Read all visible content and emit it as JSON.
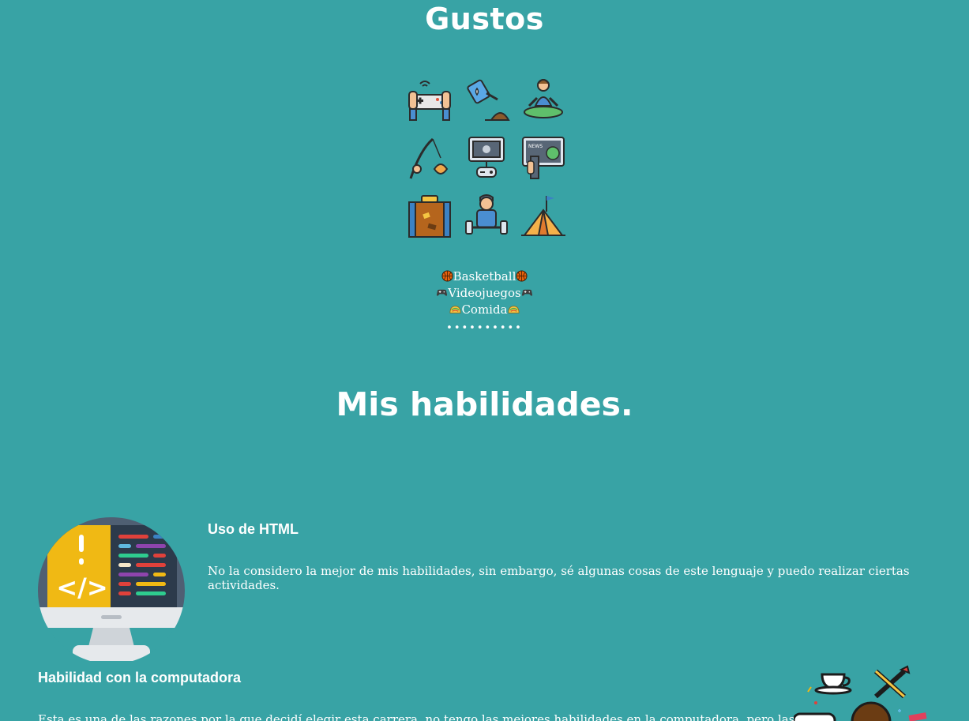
{
  "gustos": {
    "title": "Gustos",
    "icons": [
      "gamepad-icon",
      "watering-can-icon",
      "meditation-icon",
      "fishing-icon",
      "retro-tv-icon",
      "news-monitor-icon",
      "suitcase-icon",
      "weightlifting-icon",
      "camping-tent-icon"
    ],
    "likes": [
      {
        "label": "Basketball",
        "emoji": "basketball-icon"
      },
      {
        "label": "Videojuegos",
        "emoji": "game-controller-icon"
      },
      {
        "label": "Comida",
        "emoji": "taco-icon"
      }
    ],
    "dots": "••••••••••"
  },
  "skills": {
    "title": "Mis habilidades.",
    "html": {
      "heading": "Uso de HTML",
      "text": "No la considero la mejor de mis habilidades, sin embargo, sé algunas cosas de este lenguaje y puedo realizar ciertas actividades."
    },
    "computer": {
      "heading": "Habilidad con la computadora",
      "text": "Esta es una de las razones por la que decidí elegir esta carrera, no tengo las mejores habilidades en la computadora, pero las"
    }
  },
  "colors": {
    "background": "#38a3a5",
    "text": "#ffffff"
  }
}
